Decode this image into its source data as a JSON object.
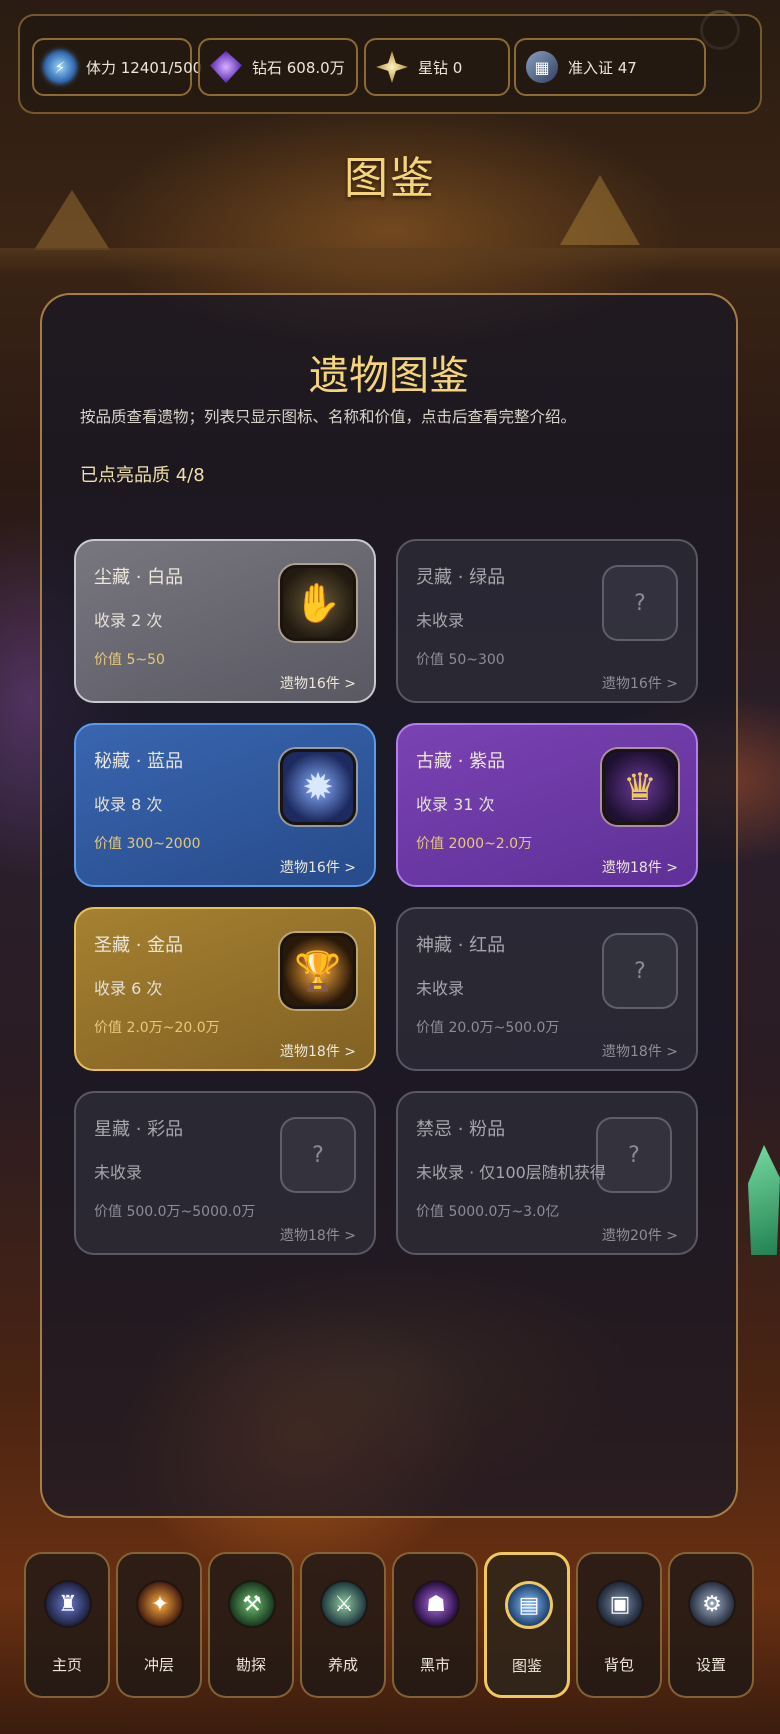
{
  "resources": [
    {
      "icon": "stamina-icon",
      "text": "体力 12401/500"
    },
    {
      "icon": "diamond-icon",
      "text": "钻石 608.0万"
    },
    {
      "icon": "star-diamond-icon",
      "text": "星钻 0"
    },
    {
      "icon": "entry-pass-icon",
      "text": "准入证 47"
    }
  ],
  "page_title": "图鉴",
  "panel": {
    "title": "遗物图鉴",
    "description": "按品质查看遗物；列表只显示图标、名称和价值，点击后查看完整介绍。",
    "progress": "已点亮品质 4/8"
  },
  "cards": [
    {
      "name": "尘藏 · 白品",
      "status": "收录 2 次",
      "value": "价值 5~50",
      "count": "遗物16件 >",
      "rarity": "white",
      "unlocked": true,
      "icon": "gauntlet-icon"
    },
    {
      "name": "灵藏 · 绿品",
      "status": "未收录",
      "value": "价值 50~300",
      "count": "遗物16件 >",
      "rarity": "green",
      "unlocked": false,
      "placeholder": "?"
    },
    {
      "name": "秘藏 · 蓝品",
      "status": "收录 8 次",
      "value": "价值 300~2000",
      "count": "遗物16件 >",
      "rarity": "blue",
      "unlocked": true,
      "icon": "sigil-icon"
    },
    {
      "name": "古藏 · 紫品",
      "status": "收录 31 次",
      "value": "价值 2000~2.0万",
      "count": "遗物18件 >",
      "rarity": "purple",
      "unlocked": true,
      "icon": "crown-icon"
    },
    {
      "name": "圣藏 · 金品",
      "status": "收录 6 次",
      "value": "价值 2.0万~20.0万",
      "count": "遗物18件 >",
      "rarity": "gold",
      "unlocked": true,
      "icon": "grail-icon"
    },
    {
      "name": "神藏 · 红品",
      "status": "未收录",
      "value": "价值 20.0万~500.0万",
      "count": "遗物18件 >",
      "rarity": "red",
      "unlocked": false,
      "placeholder": "?"
    },
    {
      "name": "星藏 · 彩品",
      "status": "未收录",
      "value": "价值 500.0万~5000.0万",
      "count": "遗物18件 >",
      "rarity": "rainbow",
      "unlocked": false,
      "placeholder": "?"
    },
    {
      "name": "禁忌 · 粉品",
      "status": "未收录 · 仅100层随机获得",
      "value": "价值 5000.0万~3.0亿",
      "count": "遗物20件 >",
      "rarity": "pink",
      "unlocked": false,
      "placeholder": "?"
    }
  ],
  "nav": [
    {
      "label": "主页",
      "icon": "home-icon",
      "active": false
    },
    {
      "label": "冲层",
      "icon": "climb-icon",
      "active": false
    },
    {
      "label": "勘探",
      "icon": "explore-icon",
      "active": false
    },
    {
      "label": "养成",
      "icon": "train-icon",
      "active": false
    },
    {
      "label": "黑市",
      "icon": "black-market-icon",
      "active": false
    },
    {
      "label": "图鉴",
      "icon": "codex-icon",
      "active": true
    },
    {
      "label": "背包",
      "icon": "backpack-icon",
      "active": false
    },
    {
      "label": "设置",
      "icon": "settings-icon",
      "active": false
    }
  ],
  "colors": {
    "gold_text": "#f5d47a",
    "panel_border": "#c89650",
    "white_card": "#c8c8cf",
    "blue_card": "#5a9ae8",
    "purple_card": "#b37cf0",
    "gold_card": "#e8c060"
  }
}
